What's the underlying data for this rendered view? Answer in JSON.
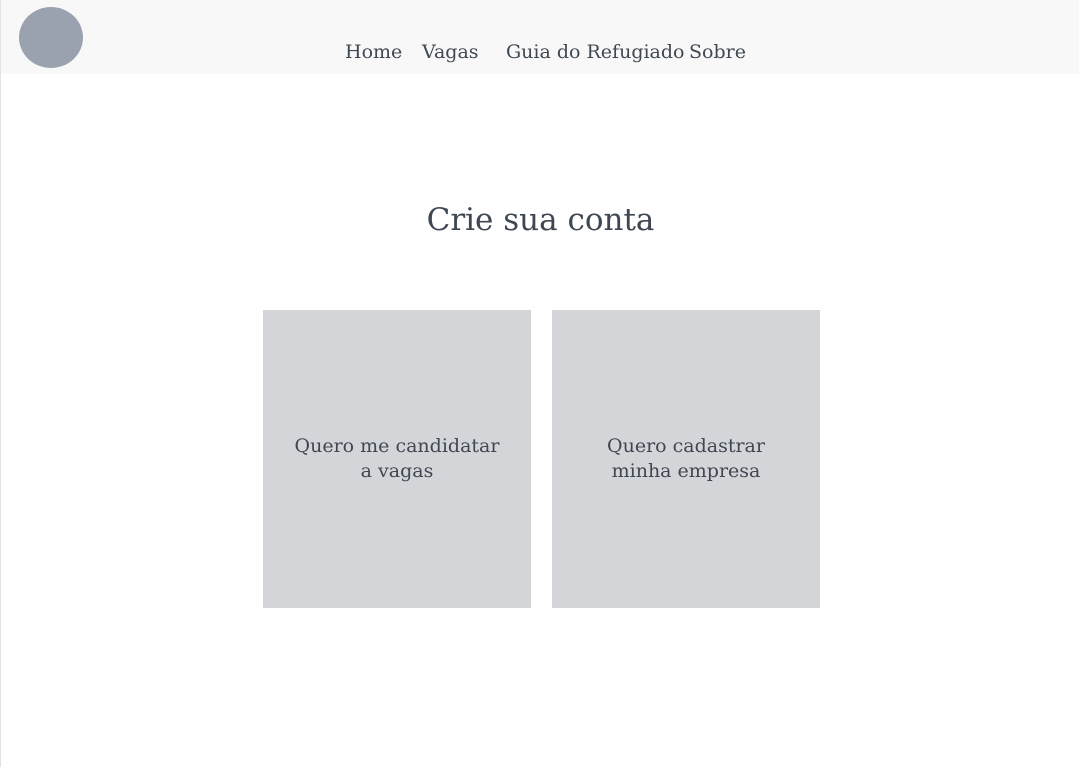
{
  "header": {
    "logo_icon": "avatar-circle-icon",
    "nav": {
      "home": "Home",
      "vagas": "Vagas",
      "guia": "Guia do Refugiado",
      "sobre": "Sobre"
    }
  },
  "main": {
    "title": "Crie sua conta",
    "options": [
      {
        "line1": "Quero me candidatar",
        "line2": "a vagas"
      },
      {
        "line1": "Quero cadastrar",
        "line2": "minha empresa"
      }
    ]
  },
  "colors": {
    "header_bg": "#f8f8f8",
    "logo": "#9aa2b0",
    "card_bg": "#d4d5d9",
    "text": "#3f4753"
  }
}
